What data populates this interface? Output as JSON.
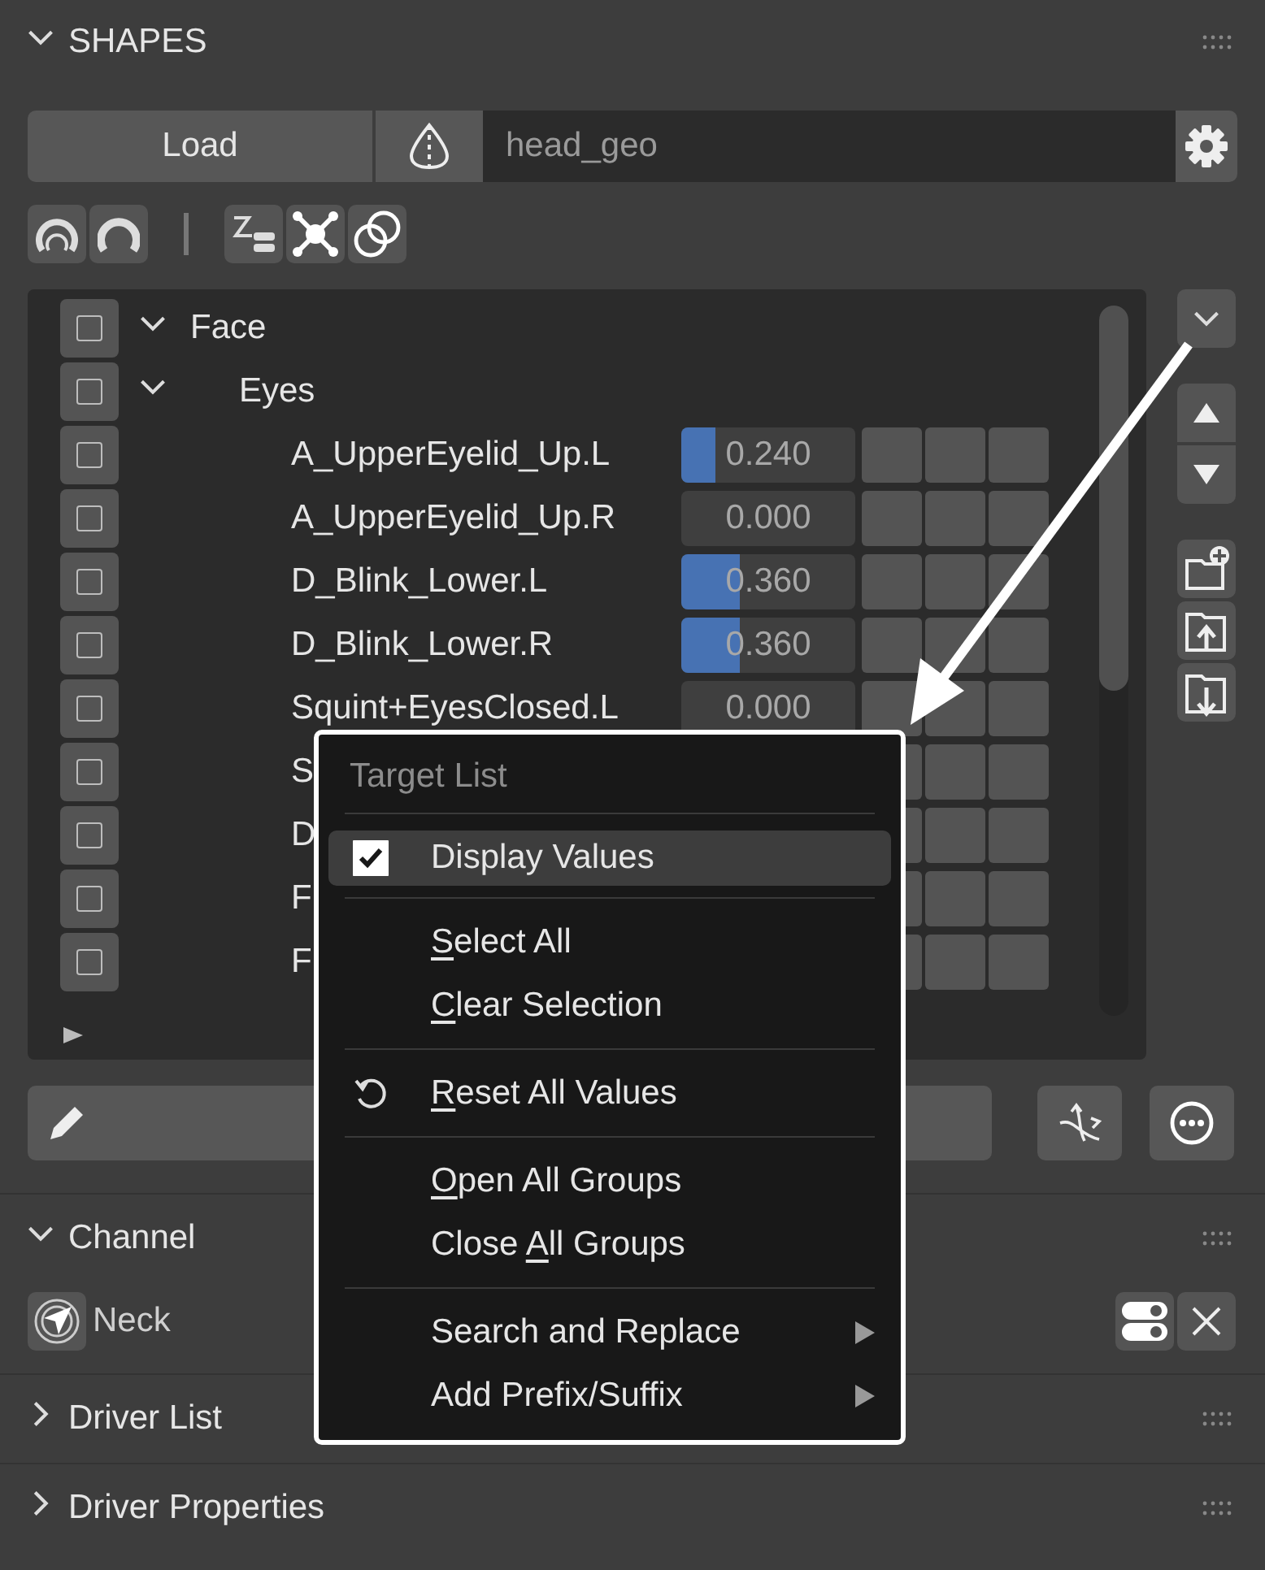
{
  "panel": {
    "title": "SHAPES",
    "expanded": true
  },
  "load_row": {
    "button": "Load",
    "field_value": "head_geo"
  },
  "tree": [
    {
      "kind": "group",
      "label": "Face",
      "expanded": true,
      "checked": false,
      "children": [
        {
          "kind": "group",
          "label": "Eyes",
          "expanded": true,
          "checked": false,
          "children": [
            {
              "kind": "shape",
              "label": "A_UpperEyelid_Up.L",
              "checked": false,
              "value": "0.240",
              "level": 0.2
            },
            {
              "kind": "shape",
              "label": "A_UpperEyelid_Up.R",
              "checked": false,
              "value": "0.000",
              "level": 0
            },
            {
              "kind": "shape",
              "label": "D_Blink_Lower.L",
              "checked": false,
              "value": "0.360",
              "level": 0.34
            },
            {
              "kind": "shape",
              "label": "D_Blink_Lower.R",
              "checked": false,
              "value": "0.360",
              "level": 0.34
            },
            {
              "kind": "shape",
              "label": "Squint+EyesClosed.L",
              "checked": false,
              "value": "0.000",
              "level": 0
            },
            {
              "kind": "shape",
              "label": "S",
              "checked": false
            },
            {
              "kind": "shape",
              "label": "D",
              "checked": false
            },
            {
              "kind": "shape",
              "label": "F",
              "checked": false
            },
            {
              "kind": "shape",
              "label": "F",
              "checked": false
            }
          ]
        }
      ]
    }
  ],
  "menu": {
    "title": "Target List",
    "sections": [
      [
        {
          "kind": "check",
          "checked": true,
          "selected": true,
          "before": "Display Values"
        }
      ],
      [
        {
          "kind": "plain",
          "selected": false,
          "key": "S",
          "after": "elect All"
        },
        {
          "kind": "plain",
          "selected": false,
          "key": "C",
          "after": "lear Selection"
        }
      ],
      [
        {
          "kind": "reset",
          "selected": false,
          "key": "R",
          "after": "eset All Values"
        }
      ],
      [
        {
          "kind": "plain",
          "selected": false,
          "key": "O",
          "after": "pen All Groups"
        },
        {
          "kind": "plain",
          "selected": false,
          "before": "Close ",
          "key": "A",
          "after": "ll Groups"
        }
      ],
      [
        {
          "kind": "submenu",
          "selected": false,
          "before": "Search and Replace"
        },
        {
          "kind": "submenu",
          "selected": false,
          "before": "Add Prefix/Suffix"
        }
      ]
    ]
  },
  "channel": {
    "title": "Channel",
    "expanded": true,
    "bone": "Neck"
  },
  "collapsed_sections": [
    {
      "title": "Driver List",
      "expanded": false
    },
    {
      "title": "Driver Properties",
      "expanded": false
    }
  ]
}
